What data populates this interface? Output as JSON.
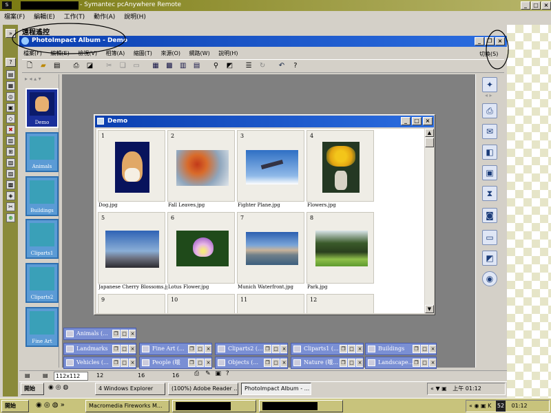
{
  "remote_window": {
    "title": "- Symantec pcAnywhere Remote",
    "menu": [
      "檔案(F)",
      "編輯(E)",
      "工作(T)",
      "動作(A)",
      "說明(H)"
    ],
    "panel_label": "遠程遙控"
  },
  "app_window": {
    "title": "PhotoImpact Album - Demo",
    "menu": [
      "檔案(F)",
      "編輯(E)",
      "檢視(V)",
      "相簿(A)",
      "縮圖(T)",
      "來源(O)",
      "網路(W)",
      "說明(H)"
    ],
    "switch_label": "切換(S)"
  },
  "albums": [
    "Demo",
    "Animals",
    "Buildings",
    "Cliparts1",
    "Cliparts2",
    "Fine Art"
  ],
  "demo_window": {
    "title": "Demo",
    "thumbnails": [
      {
        "num": "1",
        "name": "Dog.jpg"
      },
      {
        "num": "2",
        "name": "Fall Leaves.jpg"
      },
      {
        "num": "3",
        "name": "Fighter Plane.jpg"
      },
      {
        "num": "4",
        "name": "Flowers.jpg"
      },
      {
        "num": "5",
        "name": "Japanese Cherry Blossoms.jpg"
      },
      {
        "num": "6",
        "name": "Lotus Flower.jpg"
      },
      {
        "num": "7",
        "name": "Munich Waterfront.jpg"
      },
      {
        "num": "8",
        "name": "Park.jpg"
      },
      {
        "num": "9",
        "name": ""
      },
      {
        "num": "10",
        "name": ""
      },
      {
        "num": "11",
        "name": ""
      },
      {
        "num": "12",
        "name": ""
      }
    ]
  },
  "minimized_windows": [
    "Animals (...",
    "Landmarks",
    "Fine Art (...",
    "Cliparts2 (...",
    "Cliparts1 (...",
    "Buildings",
    "Vehicles (...",
    "People (哦",
    "Objects (...",
    "Nature (哦...",
    "Landscape..."
  ],
  "status_bar": {
    "size": "112x112",
    "count1": "12",
    "count2": "16",
    "count3": "16"
  },
  "inner_taskbar": {
    "start": "開始",
    "tasks": [
      "4 Windows Explorer",
      "(100%) Adobe Reader ...",
      "PhotoImpact Album - ..."
    ],
    "clock": "上午 01:12"
  },
  "outer_taskbar": {
    "start": "開始",
    "tasks": [
      "Macromedia Fireworks M...",
      "",
      ""
    ],
    "tray_number": "52",
    "clock": "01:12"
  }
}
